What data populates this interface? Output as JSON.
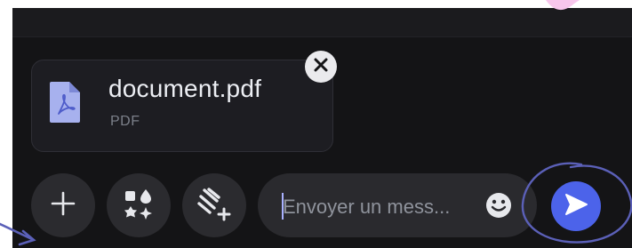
{
  "attachment": {
    "file_name": "document.pdf",
    "file_type": "PDF",
    "icon": "pdf-file-icon",
    "remove_icon": "close-icon"
  },
  "composer": {
    "add_icon": "plus-icon",
    "apps_icon": "shapes-icon",
    "ai_icon": "magic-wand-icon",
    "input_placeholder": "Envoyer un mess...",
    "emoji_icon": "emoji-icon",
    "send_icon": "send-icon"
  },
  "colors": {
    "background": "#141416",
    "card": "#1d1d22",
    "button": "#2b2b2f",
    "accent": "#4c63ea",
    "annotation": "#5b60b8"
  }
}
